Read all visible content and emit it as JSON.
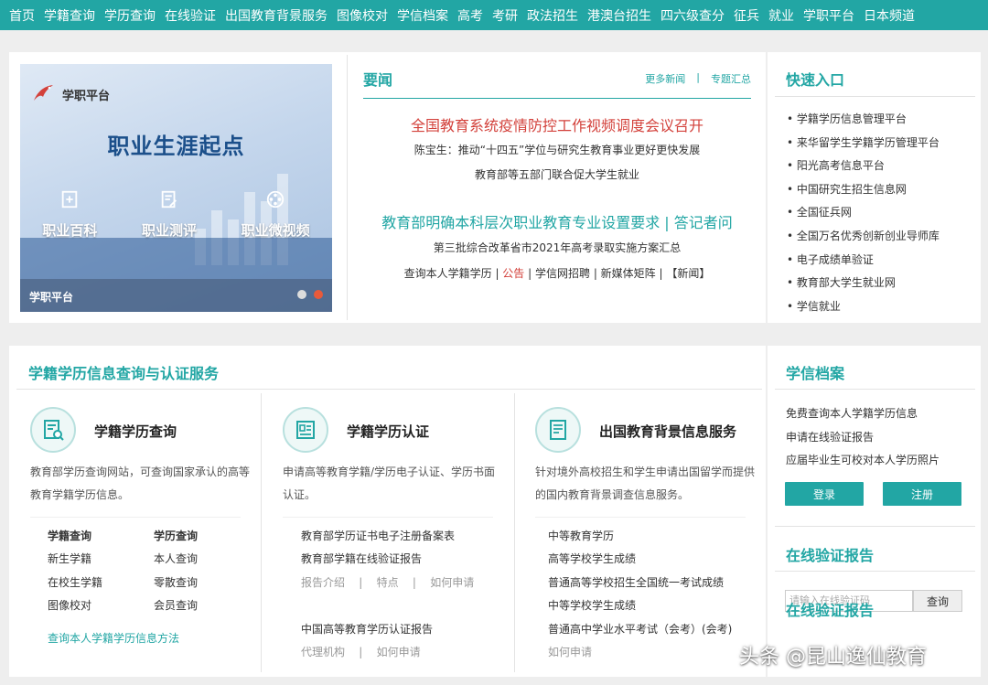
{
  "nav": {
    "items": [
      "首页",
      "学籍查询",
      "学历查询",
      "在线验证",
      "出国教育背景服务",
      "图像校对",
      "学信档案",
      "高考",
      "考研",
      "政法招生",
      "港澳台招生",
      "四六级查分",
      "征兵",
      "就业",
      "学职平台",
      "日本频道"
    ]
  },
  "banner": {
    "logo_text": "学职平台",
    "title": "职业生涯起点",
    "items": [
      "职业百科",
      "职业测评",
      "职业微视频"
    ],
    "footer_label": "学职平台"
  },
  "news": {
    "heading": "要闻",
    "more_link": "更多新闻",
    "separator": "|",
    "topics_link": "专题汇总",
    "headline1": "全国教育系统疫情防控工作视频调度会议召开",
    "line2": "陈宝生：推动“十四五”学位与研究生教育事业更好更快发展",
    "line3": "教育部等五部门联合促大学生就业",
    "headline2": "教育部明确本科层次职业教育专业设置要求 | 答记者问",
    "line5": "第三批综合改革省市2021年高考录取实施方案汇总",
    "line6_a": "查询本人学籍学历",
    "line6_sep1": " | ",
    "line6_b": "公告",
    "line6_sep2": " | ",
    "line6_c": "学信网招聘",
    "line6_sep3": " | ",
    "line6_d": "新媒体矩阵",
    "line6_sep4": " | ",
    "line6_e": "【新闻】"
  },
  "quick": {
    "heading": "快速入口",
    "items": [
      "学籍学历信息管理平台",
      "来华留学生学籍学历管理平台",
      "阳光高考信息平台",
      "中国研究生招生信息网",
      "全国征兵网",
      "全国万名优秀创新创业导师库",
      "电子成绩单验证",
      "教育部大学生就业网",
      "学信就业"
    ]
  },
  "service": {
    "heading": "学籍学历信息查询与认证服务",
    "col1": {
      "title": "学籍学历查询",
      "desc": "教育部学历查询网站，可查询国家承认的高等教育学籍学历信息。",
      "left_head": "学籍查询",
      "left_items": [
        "新生学籍",
        "在校生学籍",
        "图像校对"
      ],
      "right_head": "学历查询",
      "right_items": [
        "本人查询",
        "零散查询",
        "会员查询"
      ],
      "method_link": "查询本人学籍学历信息方法"
    },
    "col2": {
      "title": "学籍学历认证",
      "desc": "申请高等教育学籍/学历电子认证、学历书面认证。",
      "link1": "教育部学历证书电子注册备案表",
      "link2": "教育部学籍在线验证报告",
      "sub1": [
        "报告介绍",
        "特点",
        "如何申请"
      ],
      "link3": "中国高等教育学历认证报告",
      "sub2": [
        "代理机构",
        "如何申请"
      ],
      "sep": "|"
    },
    "col3": {
      "title": "出国教育背景信息服务",
      "desc": "针对境外高校招生和学生申请出国留学而提供的国内教育背景调查信息服务。",
      "links": [
        "中等教育学历",
        "高等学校学生成绩",
        "普通高等学校招生全国统一考试成绩",
        "中等学校学生成绩",
        "普通高中学业水平考试（会考）(会考)"
      ],
      "apply": "如何申请"
    }
  },
  "archive": {
    "heading": "学信档案",
    "items": [
      "免费查询本人学籍学历信息",
      "申请在线验证报告",
      "应届毕业生可校对本人学历照片"
    ],
    "login": "登录",
    "register": "注册"
  },
  "verify": {
    "heading": "在线验证报告",
    "placeholder": "请输入在线验证码",
    "search": "查询",
    "heading2": "在线验证报告"
  },
  "watermark": "头条 @昆山逸仙教育"
}
